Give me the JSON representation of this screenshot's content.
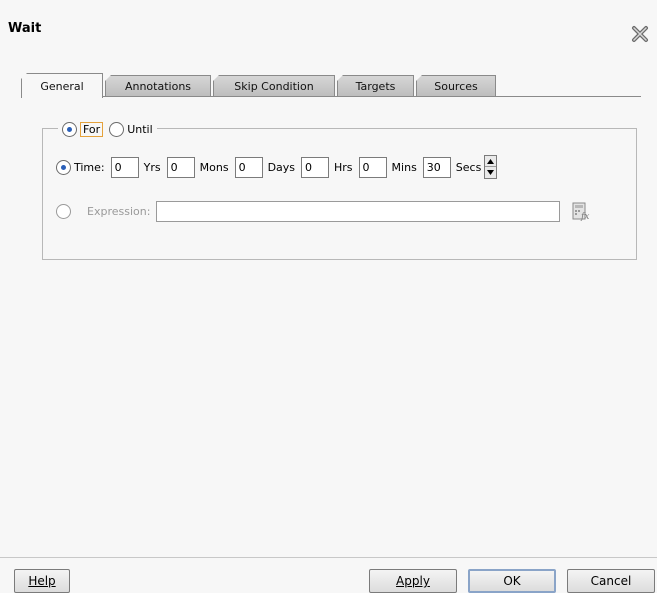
{
  "dialog": {
    "title": "Wait"
  },
  "tabs": [
    {
      "label": "General",
      "active": true
    },
    {
      "label": "Annotations",
      "active": false
    },
    {
      "label": "Skip Condition",
      "active": false
    },
    {
      "label": "Targets",
      "active": false
    },
    {
      "label": "Sources",
      "active": false
    }
  ],
  "mode": {
    "for_label": "For",
    "for_selected": true,
    "until_label": "Until",
    "until_selected": false
  },
  "time": {
    "selected": true,
    "label": "Time:",
    "fields": [
      {
        "value": "0",
        "unit": "Yrs"
      },
      {
        "value": "0",
        "unit": "Mons"
      },
      {
        "value": "0",
        "unit": "Days"
      },
      {
        "value": "0",
        "unit": "Hrs"
      },
      {
        "value": "0",
        "unit": "Mins"
      },
      {
        "value": "30",
        "unit": "Secs"
      }
    ]
  },
  "expression": {
    "selected": false,
    "label": "Expression:",
    "value": ""
  },
  "buttons": {
    "help": "Help",
    "apply": "Apply",
    "ok": "OK",
    "cancel": "Cancel"
  },
  "icons": {
    "close": "close-icon",
    "expression_builder": "expression-builder-icon",
    "spinner": "spinner-icon"
  }
}
